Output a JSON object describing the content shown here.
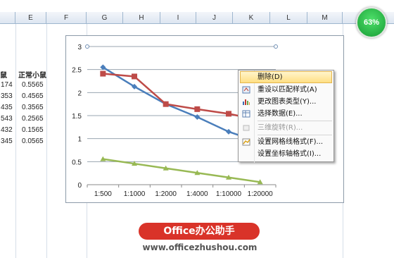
{
  "spreadsheet": {
    "columns": [
      "E",
      "F",
      "G",
      "H",
      "I",
      "J",
      "K",
      "L",
      "M"
    ],
    "rows": [
      {
        "d": "鼠",
        "e": "正常小鼠"
      },
      {
        "d": "174",
        "e": "0.5565"
      },
      {
        "d": "353",
        "e": "0.4565"
      },
      {
        "d": "435",
        "e": "0.3565"
      },
      {
        "d": "543",
        "e": "0.2565"
      },
      {
        "d": "432",
        "e": "0.1565"
      },
      {
        "d": "345",
        "e": "0.0565"
      }
    ]
  },
  "chart_data": {
    "type": "line",
    "categories": [
      "1:500",
      "1:1000",
      "1:2000",
      "1:4000",
      "1:10000",
      "1:20000"
    ],
    "ylim": [
      0,
      3
    ],
    "yticks": [
      "0",
      "0.5",
      "1",
      "1.5",
      "2",
      "2.5",
      "3"
    ],
    "series": [
      {
        "color": "#4a7ebb",
        "values": [
          2.55,
          2.13,
          1.75,
          1.47,
          1.15,
          0.92
        ]
      },
      {
        "color": "#be4b48",
        "values": [
          2.41,
          2.35,
          1.75,
          1.64,
          1.54,
          1.4
        ]
      },
      {
        "color": "#98b954",
        "values": [
          0.5565,
          0.4565,
          0.3565,
          0.2565,
          0.1565,
          0.0565
        ]
      }
    ],
    "grid": true
  },
  "context_menu": {
    "items": [
      {
        "label": "删除(D)",
        "icon": "none",
        "selected": true
      },
      {
        "label": "重设以匹配样式(A)",
        "icon": "reset-style-icon"
      },
      {
        "label": "更改图表类型(Y)...",
        "icon": "chart-type-icon"
      },
      {
        "label": "选择数据(E)...",
        "icon": "select-data-icon"
      },
      {
        "label": "三维旋转(R)...",
        "icon": "rotate-3d-icon",
        "disabled": true
      },
      {
        "label": "设置网格线格式(F)...",
        "icon": "gridline-format-icon"
      },
      {
        "label": "设置坐标轴格式(I)...",
        "icon": "axis-format-icon"
      }
    ]
  },
  "status_gauge": {
    "value": "63%"
  },
  "watermark": {
    "brand": "Office办公助手",
    "url": "www.officezhushou.com"
  },
  "colors": {
    "accent_red": "#d93329",
    "header_border": "#9eb6ce"
  }
}
